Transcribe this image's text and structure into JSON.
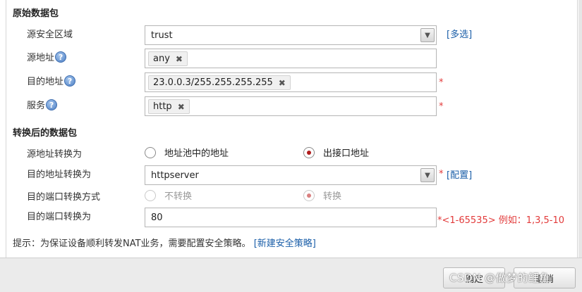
{
  "section_original": {
    "title": "原始数据包"
  },
  "src_zone": {
    "label": "源安全区域",
    "value": "trust",
    "multi_link": "[多选]"
  },
  "src_addr": {
    "label": "源地址",
    "tag": "any"
  },
  "dst_addr": {
    "label": "目的地址",
    "tag": "23.0.0.3/255.255.255.255",
    "required": "*"
  },
  "service": {
    "label": "服务",
    "tag": "http",
    "required": "*"
  },
  "section_translated": {
    "title": "转换后的数据包"
  },
  "src_translate": {
    "label": "源地址转换为",
    "option_pool": "地址池中的地址",
    "option_egress": "出接口地址"
  },
  "dst_translate": {
    "label": "目的地址转换为",
    "value": "httpserver",
    "required": "*",
    "config_link": "[配置]"
  },
  "port_mode": {
    "label": "目的端口转换方式",
    "option_no": "不转换",
    "option_yes": "转换"
  },
  "port_translate": {
    "label": "目的端口转换为",
    "value": "80",
    "range_hint": "*<1-65535> 例如：1,3,5-10"
  },
  "hint": {
    "text": "提示：为保证设备顺利转发NAT业务，需要配置安全策略。",
    "link": "[新建安全策略]"
  },
  "footer": {
    "ok_label": "确定",
    "cancel_label": "取消",
    "watermark": "CSDN @做梦的鲤鱼"
  },
  "icons": {
    "help": "?",
    "remove": "✖",
    "dropdown": "▼"
  },
  "colors": {
    "link": "#1a5ea8",
    "required": "#e23a3a",
    "radio_selected": "#b01c1c"
  }
}
